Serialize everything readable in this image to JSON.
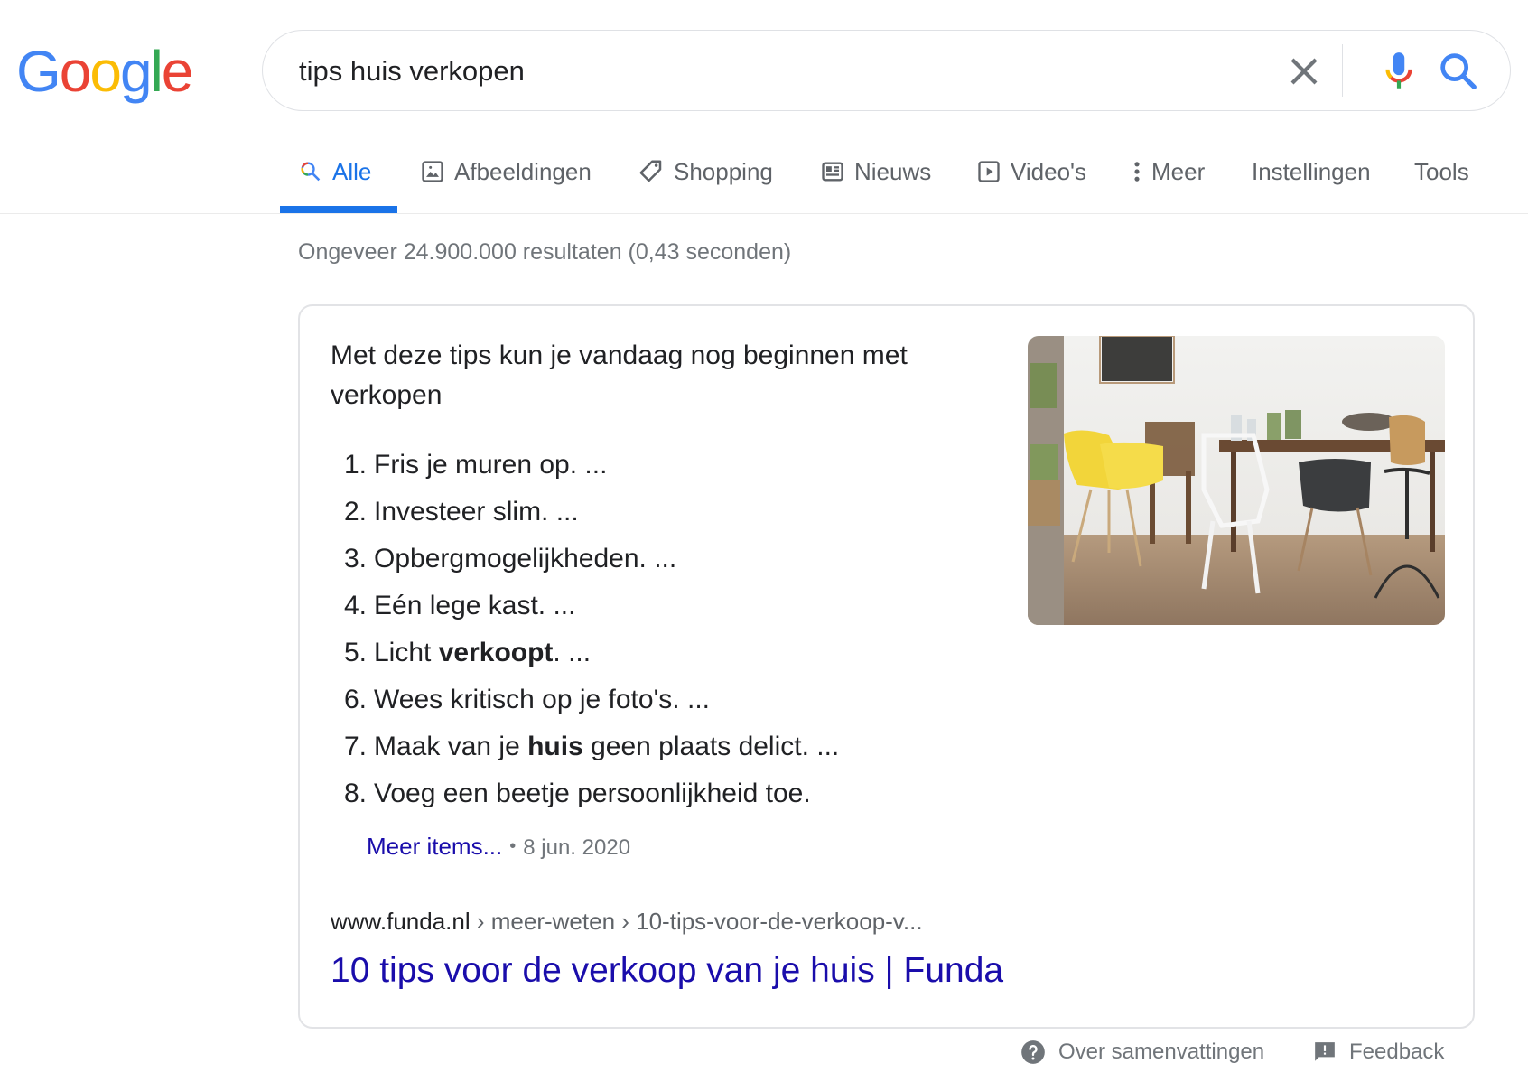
{
  "logo": {
    "letters": [
      "G",
      "o",
      "o",
      "g",
      "l",
      "e"
    ],
    "colors": [
      "#4285f4",
      "#ea4335",
      "#fbbc05",
      "#4285f4",
      "#34a853",
      "#ea4335"
    ]
  },
  "search": {
    "query": "tips huis verkopen",
    "clear_icon": "close-icon",
    "mic_icon": "microphone-icon",
    "search_icon": "search-icon"
  },
  "tabs": [
    {
      "label": "Alle",
      "icon": "search-icon",
      "active": true
    },
    {
      "label": "Afbeeldingen",
      "icon": "image-icon"
    },
    {
      "label": "Shopping",
      "icon": "tag-icon"
    },
    {
      "label": "Nieuws",
      "icon": "newspaper-icon"
    },
    {
      "label": "Video's",
      "icon": "play-icon"
    },
    {
      "label": "Meer",
      "icon": "more-vert-icon"
    },
    {
      "label": "Instellingen"
    },
    {
      "label": "Tools"
    }
  ],
  "stats": "Ongeveer 24.900.000 resultaten (0,43 seconden)",
  "snippet": {
    "title": "Met deze tips kun je vandaag nog beginnen met verkopen",
    "items": [
      {
        "num": "1.",
        "pre": "Fris je muren op. ...",
        "bold": "",
        "post": ""
      },
      {
        "num": "2.",
        "pre": "Investeer slim. ...",
        "bold": "",
        "post": ""
      },
      {
        "num": "3.",
        "pre": "Opbergmogelijkheden. ...",
        "bold": "",
        "post": ""
      },
      {
        "num": "4.",
        "pre": "Eén lege kast. ...",
        "bold": "",
        "post": ""
      },
      {
        "num": "5.",
        "pre": "Licht ",
        "bold": "verkoopt",
        "post": ". ..."
      },
      {
        "num": "6.",
        "pre": "Wees kritisch op je foto's. ...",
        "bold": "",
        "post": ""
      },
      {
        "num": "7.",
        "pre": "Maak van je ",
        "bold": "huis",
        "post": " geen plaats delict. ..."
      },
      {
        "num": "8.",
        "pre": "Voeg een beetje persoonlijkheid toe.",
        "bold": "",
        "post": ""
      }
    ],
    "more_label": "Meer items...",
    "separator": "•",
    "date": "8 jun. 2020",
    "url_host": "www.funda.nl",
    "url_path": " › meer-weten › 10-tips-voor-de-verkoop-v...",
    "result_title": "10 tips voor de verkoop van je huis | Funda",
    "image_alt": "dining room with yellow chair"
  },
  "footer": {
    "about_label": "Over samenvattingen",
    "feedback_label": "Feedback"
  },
  "colors": {
    "link": "#1a0dab",
    "accent": "#1a73e8",
    "muted": "#70757a"
  }
}
